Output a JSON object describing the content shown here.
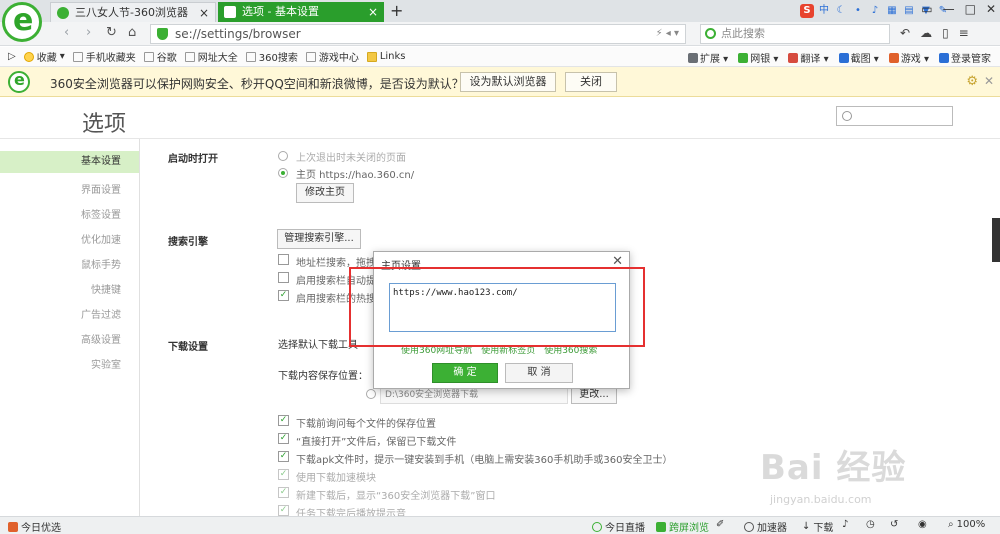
{
  "browser": {
    "tabs": [
      {
        "label": "三八女人节-360浏览器"
      },
      {
        "label": "选项 - 基本设置"
      }
    ],
    "new_tab": "+",
    "url": "se://settings/browser",
    "search_placeholder": "点此搜索"
  },
  "bookmarks": {
    "items": [
      "收藏",
      "手机收藏夹",
      "谷歌",
      "网址大全",
      "360搜索",
      "游戏中心",
      "Links"
    ],
    "right_items": [
      "扩展",
      "网银",
      "翻译",
      "截图",
      "游戏",
      "登录管家"
    ]
  },
  "infobar": {
    "text": "360安全浏览器可以保护网购安全、秒开QQ空间和新浪微博，是否设为默认？",
    "set_default": "设为默认浏览器",
    "close": "关闭"
  },
  "page": {
    "title": "选项",
    "sidebar": [
      "基本设置",
      "界面设置",
      "标签设置",
      "优化加速",
      "鼠标手势",
      "快捷键",
      "广告过滤",
      "高级设置",
      "实验室"
    ],
    "startup": {
      "label": "启动时打开",
      "opt_last": "上次退出时未关闭的页面",
      "opt_home": "主页  https://hao.360.cn/",
      "modify_btn": "修改主页"
    },
    "search_engine": {
      "label": "搜索引擎",
      "manage_btn": "管理搜索引擎...",
      "opt1": "地址栏搜索，拖拽",
      "opt2": "启用搜索栏自动提",
      "opt3": "启用搜索栏的热搜"
    },
    "download": {
      "label": "下载设置",
      "tool_label": "选择默认下载工具",
      "save_label": "下载内容保存位置：",
      "path": "D:\\360安全浏览器下载",
      "change_btn": "更改...",
      "opts": [
        "下载前询问每个文件的保存位置",
        "“直接打开”文件后，保留已下载文件",
        "下载apk文件时，提示一键安装到手机（电脑上需安装360手机助手或360安全卫士）",
        "使用下载加速模块",
        "新建下载后，显示“360安全浏览器下载”窗口",
        "任务下载完后播放提示音"
      ]
    }
  },
  "dialog": {
    "title": "主页设置",
    "value": "https://www.hao123.com/",
    "links": [
      "使用360网址导航",
      "使用新标签页",
      "使用360搜索"
    ],
    "ok": "确 定",
    "cancel": "取 消"
  },
  "statusbar": {
    "left": "今日优选",
    "items": [
      "今日直播",
      "跨屏浏览",
      "加速器",
      "下载"
    ],
    "zoom": "100%"
  },
  "watermark": {
    "main": "Bai 经验",
    "sub": "jingyan.baidu.com"
  },
  "colors": {
    "brand_green": "#3cb034",
    "highlight_red": "#e53030",
    "info_bg": "#fff8d8"
  }
}
